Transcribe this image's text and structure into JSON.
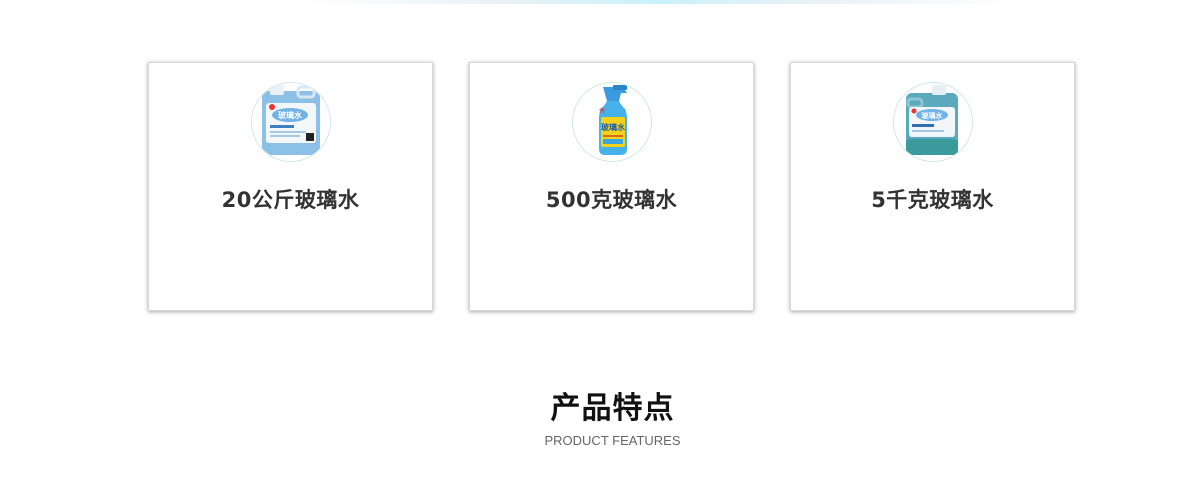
{
  "products": [
    {
      "name": "20公斤玻璃水",
      "image_icon": "large-jug-product-image"
    },
    {
      "name": "500克玻璃水",
      "image_icon": "spray-bottle-product-image"
    },
    {
      "name": "5千克玻璃水",
      "image_icon": "small-jug-product-image"
    }
  ],
  "features_section": {
    "title": "产品特点",
    "subtitle": "PRODUCT FEATURES"
  },
  "colors": {
    "jug_blue": "#7db6dc",
    "spray_blue": "#3aa6e0",
    "label_yellow": "#f4d21a",
    "jug_teal": "#4a9fb0",
    "card_title": "#333333"
  }
}
